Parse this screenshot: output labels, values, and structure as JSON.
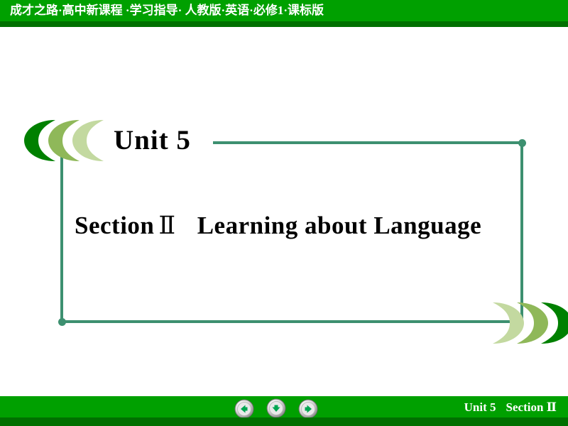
{
  "header": {
    "banner_text": "成才之路·高中新课程 ·学习指导· 人教版·英语·必修1·课标版",
    "bar_color": "#00a000",
    "bar_shadow_color": "#007000",
    "text_color": "#ffffff"
  },
  "slide": {
    "unit_title": "Unit 5",
    "section_label": "Section",
    "section_number": "Ⅱ",
    "section_name": "Learning about Language",
    "frame_color": "#3d9070",
    "text_color": "#000000"
  },
  "decorations": {
    "crescent_colors": [
      "#008000",
      "#8fb859",
      "#c3d9a0"
    ],
    "top_left_group": "crescents-pointing-left",
    "bottom_right_group": "crescents-pointing-right"
  },
  "footer": {
    "unit_label": "Unit 5",
    "section_label": "Section",
    "section_number": "Ⅱ",
    "bar_color": "#00a000",
    "bar_shadow_color": "#007000",
    "text_color": "#ffffff",
    "nav": {
      "prev": "previous-slide",
      "down": "next-step",
      "next": "next-slide",
      "arrow_color": "#00a651"
    }
  }
}
